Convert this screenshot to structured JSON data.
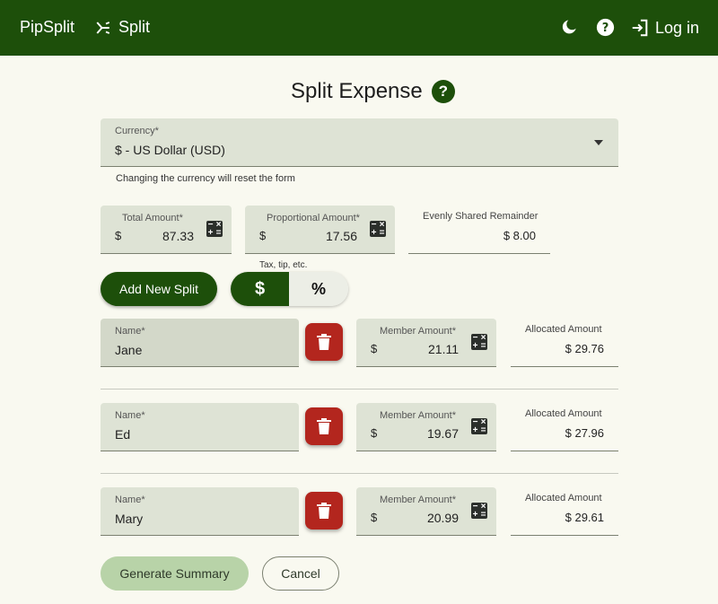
{
  "nav": {
    "brand": "PipSplit",
    "split_label": "Split",
    "login_label": "Log in"
  },
  "page": {
    "title": "Split Expense",
    "help_glyph": "?"
  },
  "currency": {
    "label": "Currency*",
    "value": "$ - US Dollar (USD)",
    "helper": "Changing the currency will reset the form"
  },
  "totals": {
    "total_label": "Total Amount*",
    "total_symbol": "$",
    "total_value": "87.33",
    "proportional_label": "Proportional Amount*",
    "proportional_symbol": "$",
    "proportional_value": "17.56",
    "proportional_hint": "Tax, tip, etc.",
    "remainder_label": "Evenly Shared Remainder",
    "remainder_value": "$ 8.00"
  },
  "actions": {
    "add_split": "Add New Split",
    "toggle_dollar": "$",
    "toggle_percent": "%",
    "generate": "Generate Summary",
    "cancel": "Cancel"
  },
  "members": [
    {
      "name_label": "Name*",
      "name": "Jane",
      "amount_label": "Member Amount*",
      "symbol": "$",
      "amount": "21.11",
      "allocated_label": "Allocated Amount",
      "allocated": "$ 29.76"
    },
    {
      "name_label": "Name*",
      "name": "Ed",
      "amount_label": "Member Amount*",
      "symbol": "$",
      "amount": "19.67",
      "allocated_label": "Allocated Amount",
      "allocated": "$ 27.96"
    },
    {
      "name_label": "Name*",
      "name": "Mary",
      "amount_label": "Member Amount*",
      "symbol": "$",
      "amount": "20.99",
      "allocated_label": "Allocated Amount",
      "allocated": "$ 29.61"
    }
  ],
  "colors": {
    "primary": "#1d4f0a",
    "danger": "#b3261e",
    "field_bg": "#dee3d5",
    "page_bg": "#f9f9f0"
  }
}
